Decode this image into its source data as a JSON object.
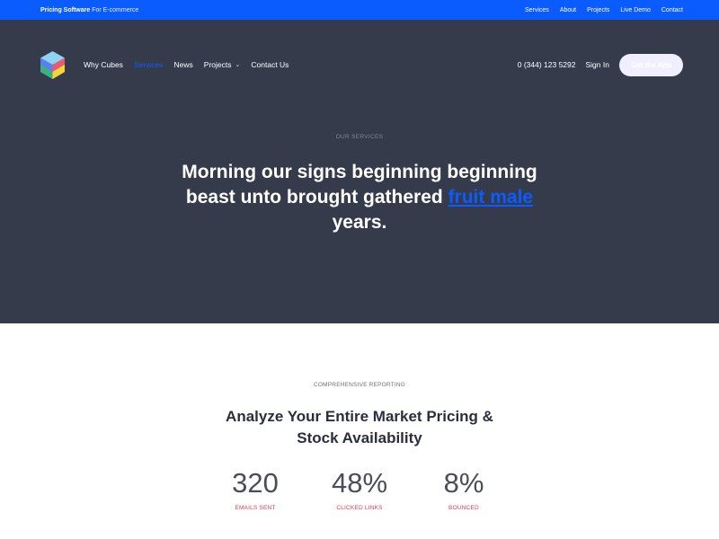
{
  "topbar": {
    "brand_bold": "Pricing Software",
    "brand_rest": "For E-commerce",
    "links": [
      "Services",
      "About",
      "Projects",
      "Live Demo",
      "Contact"
    ]
  },
  "nav": {
    "items": [
      "Why Cubes",
      "Services",
      "News",
      "Projects",
      "Contact Us"
    ],
    "active": "Services",
    "phone": "0 (344) 123 5292",
    "signin": "Sign In",
    "cta": "Get the App"
  },
  "hero": {
    "eyebrow": "OUR SERVICES",
    "headline_line1": "Morning our signs beginning beginning",
    "headline_line2_pre": "beast unto brought gathered",
    "headline_link": "fruit male",
    "headline_line3": "years."
  },
  "reporting": {
    "eyebrow": "COMPREHENSIVE REPORTING",
    "title": "Analyze Your Entire Market Pricing & Stock Availability",
    "stats": [
      {
        "value": "320",
        "label": "EMAILS SENT"
      },
      {
        "value": "48%",
        "label": "CLICKED LINKS"
      },
      {
        "value": "8%",
        "label": "BOUNCED"
      }
    ]
  },
  "colors": {
    "accent": "#0a5cff",
    "hero_bg": "#363b4c",
    "stat_label": "#e53a46"
  }
}
